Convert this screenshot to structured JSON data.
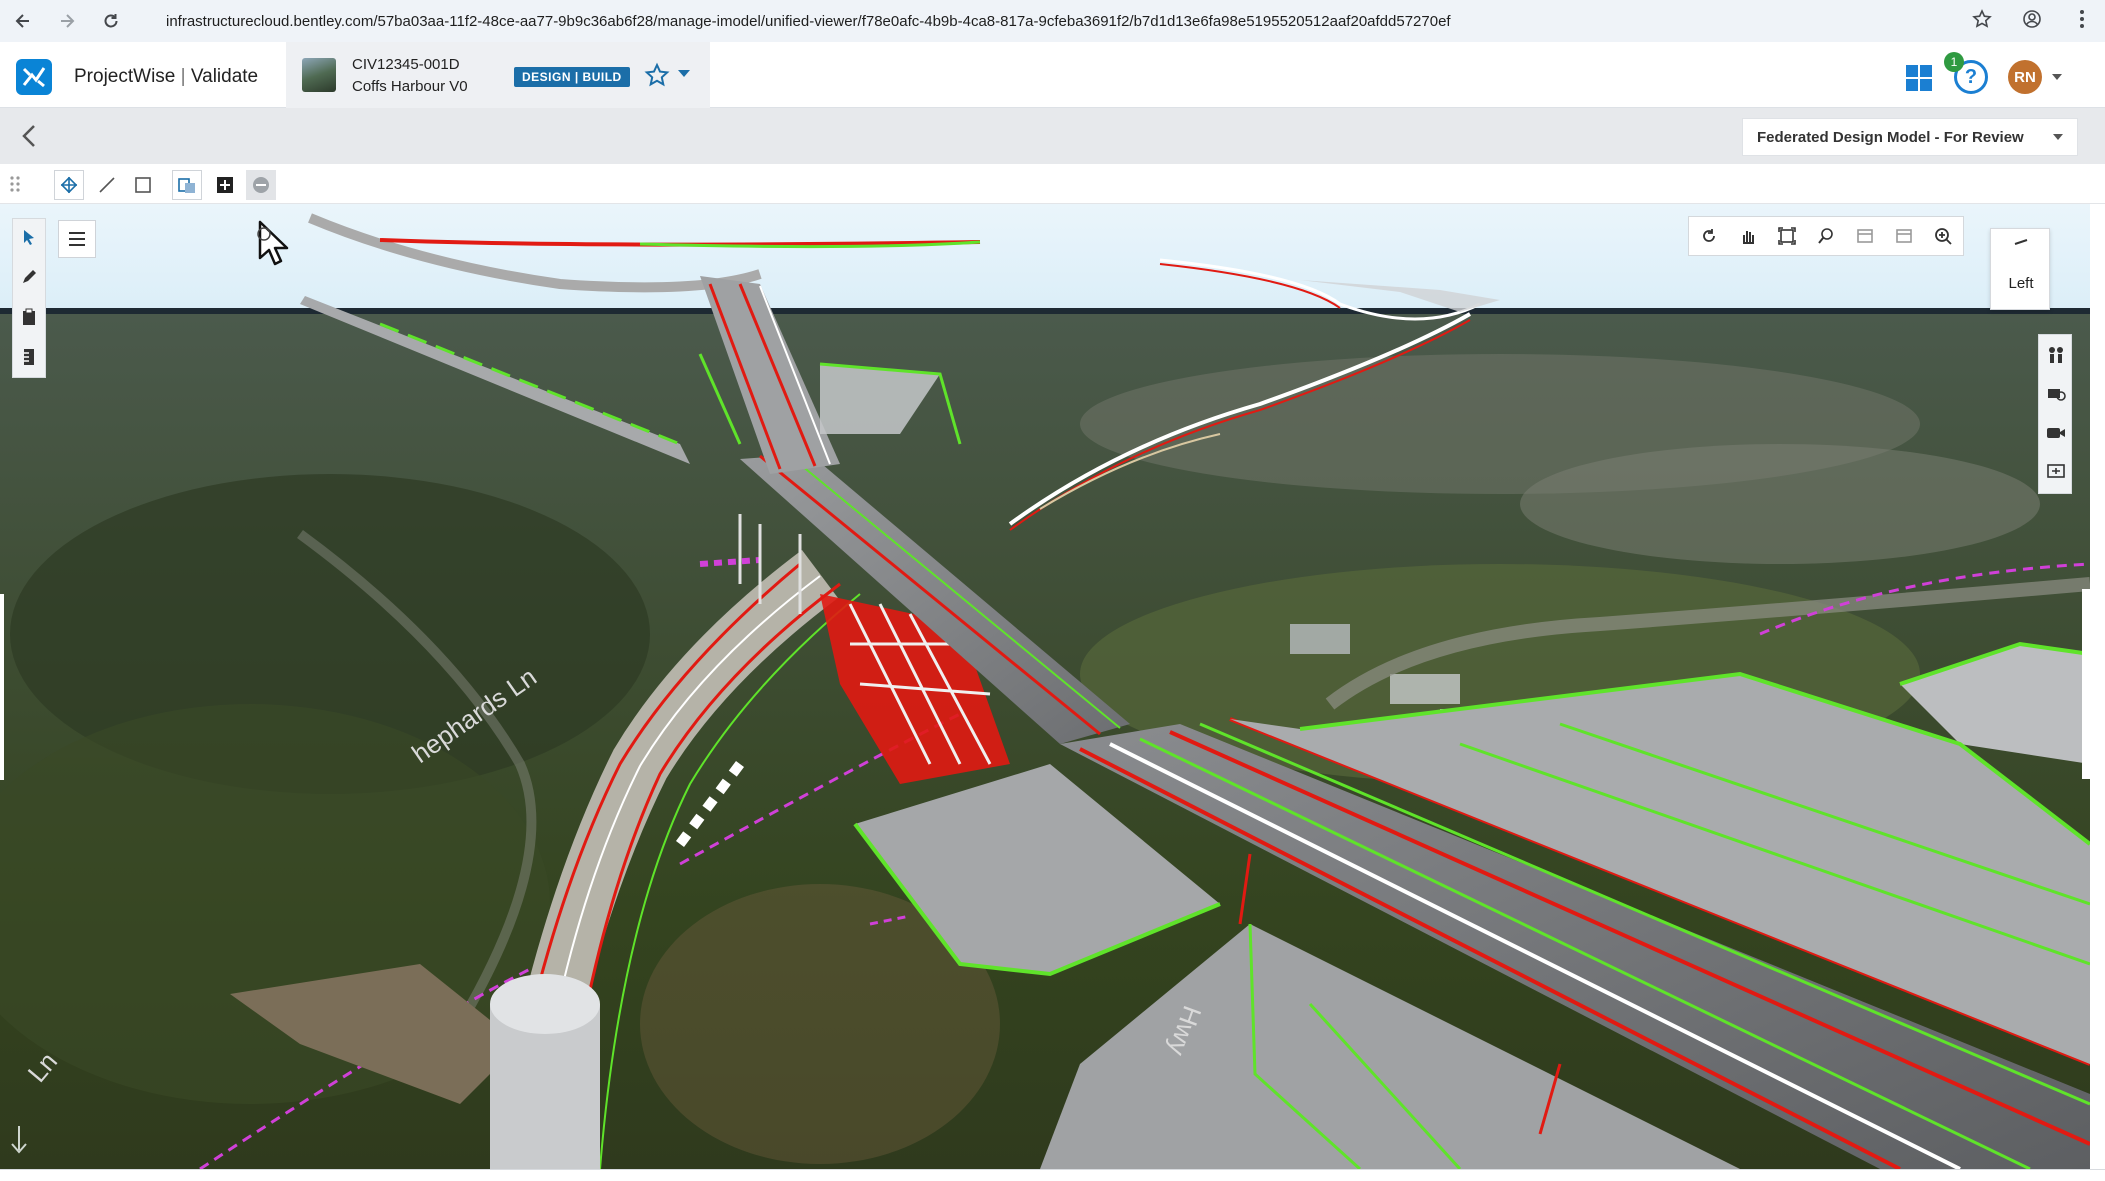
{
  "browser": {
    "url": "infrastructurecloud.bentley.com/57ba03aa-11f2-48ce-aa77-9b9c36ab6f28/manage-imodel/unified-viewer/f78e0afc-4b9b-4ca8-817a-9cfeba3691f2/b7d1d13e6fa98e5195520512aaf20afdd57270ef"
  },
  "header": {
    "app_brand": "ProjectWise",
    "app_separator": "|",
    "app_module": "Validate",
    "project_id": "CIV12345-001D",
    "project_name": "Coffs Harbour V0",
    "phase_badge": "DESIGN | BUILD",
    "notification_count": "1",
    "help_label": "?",
    "user_initials": "RN"
  },
  "subbar": {
    "model_selector": "Federated Design Model - For Review"
  },
  "viewport": {
    "view_cube_label": "Left"
  },
  "colors": {
    "brand_blue": "#0a84d6",
    "badge_blue": "#1b6ea8",
    "help_blue": "#1b7fd2",
    "notification_green": "#2f9a41",
    "avatar_orange": "#c1712e",
    "alignment_red": "#e11a12",
    "breakline_green": "#5fe32a",
    "boundary_magenta": "#d040d8"
  },
  "icons": [
    "back-arrow-icon",
    "forward-arrow-icon",
    "reload-icon",
    "site-settings-icon",
    "bookmark-star-icon",
    "profile-icon",
    "kebab-menu-icon",
    "app-logo-icon",
    "favorite-star-icon",
    "apps-grid-icon",
    "chevron-left-icon",
    "drag-grip-icon",
    "fit-view-icon",
    "measure-line-icon",
    "rectangle-select-icon",
    "section-view-icon",
    "add-icon",
    "remove-icon",
    "select-arrow-icon",
    "pencil-icon",
    "clipboard-icon",
    "ruler-icon",
    "hamburger-menu-icon",
    "rotate-icon",
    "pan-hand-icon",
    "fit-extents-icon",
    "zoom-window-icon",
    "previous-view-icon",
    "next-view-icon",
    "zoom-icon",
    "walk-icon",
    "camera-orbit-icon",
    "video-camera-icon",
    "saved-views-icon"
  ]
}
